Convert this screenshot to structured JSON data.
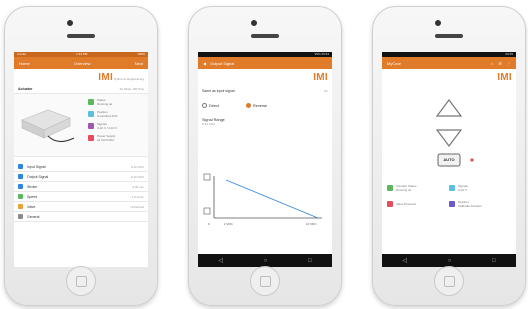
{
  "phone1": {
    "status": {
      "left": "Carrier",
      "center": "1:44 PM",
      "right": "100%"
    },
    "nav": {
      "back": "Home",
      "title": "Overview",
      "right": "Next"
    },
    "logo": "IMI",
    "logo_sub": "Hydronic Engineering",
    "actuator_label": "Actuator",
    "actuator_value": "TA-Slider 160 Plus",
    "info_tiles": [
      {
        "label": "Status",
        "value": "Running ok",
        "color": "#5cb85c"
      },
      {
        "label": "Position",
        "value": "Controlled 22%",
        "color": "#5bc0de"
      },
      {
        "label": "Signals",
        "value": "0-10 V  /  2-10 V",
        "color": "#9b59b6"
      },
      {
        "label": "Power Supply",
        "value": "24 VAC/VDC",
        "color": "#e74c5e"
      }
    ],
    "menu": [
      {
        "label": "Input Signal",
        "value": "0-10 VDC",
        "color": "#2e86de"
      },
      {
        "label": "Output Signal",
        "value": "0-10 VDC",
        "color": "#2e86de"
      },
      {
        "label": "Stroke",
        "value": "6.00 mm",
        "color": "#2e86de"
      },
      {
        "label": "Speed",
        "value": "4.0 s/mm",
        "color": "#5cb85c"
      },
      {
        "label": "Valve",
        "value": "Undefined",
        "color": "#f0a030"
      },
      {
        "label": "General",
        "value": "",
        "color": "#8a8a8a"
      }
    ]
  },
  "phone2": {
    "status": {
      "left": "",
      "right": "95% 09:54"
    },
    "title": "Output Signal",
    "logo": "IMI",
    "same_label": "Same as input signal",
    "same_toggle": "On",
    "direct": "Direct",
    "reverse": "Reverse",
    "range_label": "Signal Range",
    "range_value": "0-10 VDC",
    "axis_left": "2 VDC",
    "axis_right": "10 VDC",
    "axis_origin": "0"
  },
  "phone3": {
    "status": {
      "left": "",
      "right": "09:55"
    },
    "title": "MyCore",
    "logo": "IMI",
    "auto_label": "AUTO",
    "tiles": [
      {
        "label": "Actuator Status",
        "sub": "Running ok",
        "color": "#5cb85c"
      },
      {
        "label": "Signals",
        "sub": "0-10 V",
        "color": "#5bc0de"
      },
      {
        "label": "Valve Powered",
        "sub": "",
        "color": "#e74c5e"
      },
      {
        "label": "Position",
        "sub": "Calibrate Actuator",
        "color": "#6a5acd"
      }
    ]
  }
}
